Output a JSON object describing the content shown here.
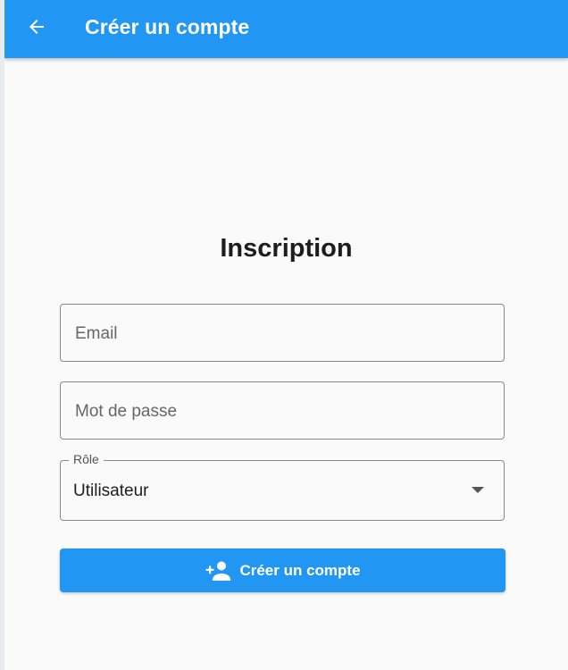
{
  "appbar": {
    "title": "Créer un compte",
    "back_icon": "arrow-left-icon",
    "color": "#2196f3"
  },
  "form": {
    "heading": "Inscription",
    "email": {
      "placeholder": "Email",
      "value": ""
    },
    "password": {
      "placeholder": "Mot de passe",
      "value": ""
    },
    "role": {
      "label": "Rôle",
      "selected": "Utilisateur",
      "icon": "dropdown-arrow-icon"
    },
    "submit": {
      "label": "Créer un compte",
      "icon": "person-add-icon",
      "color": "#2196f3"
    }
  }
}
